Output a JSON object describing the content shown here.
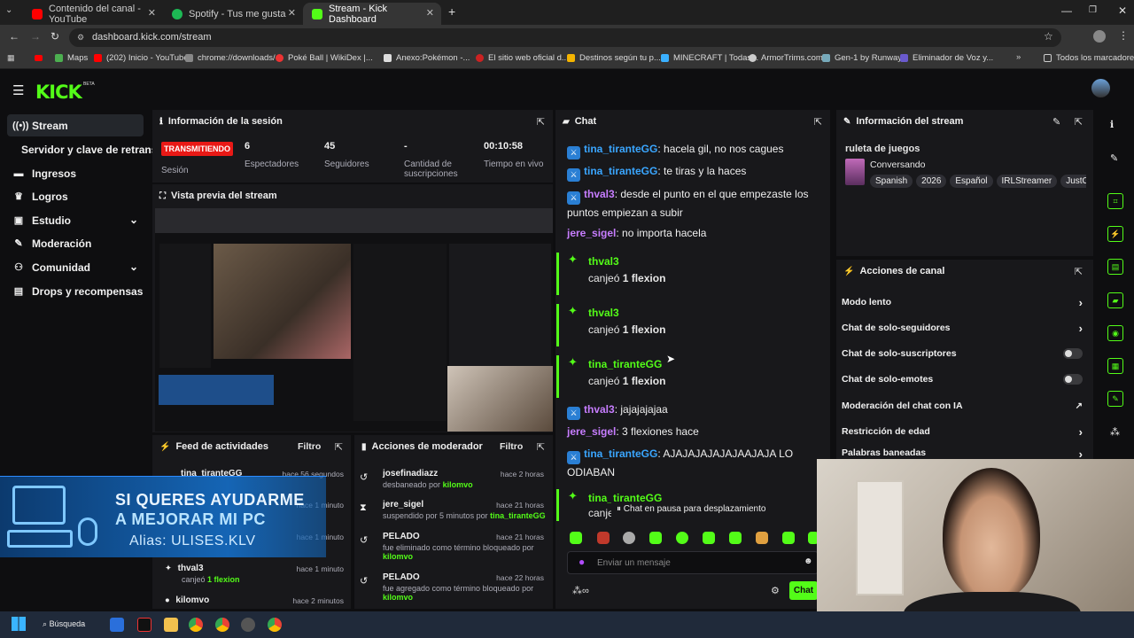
{
  "browser": {
    "tabs": [
      {
        "label": "Contenido del canal - YouTube",
        "color": "#ff0000"
      },
      {
        "label": "Spotify - Tus me gusta",
        "color": "#1db954"
      },
      {
        "label": "Stream - Kick Dashboard",
        "color": "#53fc18"
      }
    ],
    "url": "dashboard.kick.com/stream",
    "bookmarks": [
      "Maps",
      "(202) Inicio - YouTube",
      "chrome://downloads/",
      "Poké Ball | WikiDex |...",
      "Anexo:Pokémon -...",
      "El sitio web oficial d...",
      "Destinos según tu p...",
      "MINECRAFT | Todas...",
      "ArmorTrims.com",
      "Gen-1 by Runway",
      "Eliminador de Voz y...",
      "Todos los marcadores"
    ]
  },
  "kick": {
    "logo": "KICK",
    "logo_badge": "BETA",
    "sidebar": [
      {
        "label": "Stream",
        "icon": "broadcast-icon"
      },
      {
        "label": "Servidor y clave de retransmisión",
        "icon": ""
      },
      {
        "label": "Ingresos",
        "icon": "wallet-icon"
      },
      {
        "label": "Logros",
        "icon": "trophy-icon"
      },
      {
        "label": "Estudio",
        "icon": "studio-icon"
      },
      {
        "label": "Moderación",
        "icon": "wrench-icon"
      },
      {
        "label": "Comunidad",
        "icon": "community-icon"
      },
      {
        "label": "Drops y recompensas",
        "icon": "gift-icon"
      }
    ],
    "session": {
      "title": "Información de la sesión",
      "status": "TRANSMITIENDO",
      "status_label": "Sesión",
      "stats": [
        {
          "value": "6",
          "label": "Espectadores"
        },
        {
          "value": "45",
          "label": "Seguidores"
        },
        {
          "value": "-",
          "label": "Cantidad de suscripciones"
        },
        {
          "value": "00:10:58",
          "label": "Tiempo en vivo"
        }
      ]
    },
    "preview": {
      "title": "Vista previa del stream"
    },
    "overlay": {
      "line1": "SI QUERES AYUDARME",
      "line2": "A MEJORAR MI PC",
      "line3": "Alias: ULISES.KLV"
    },
    "activity": {
      "title": "Feed de actividades",
      "filter": "Filtro",
      "items": [
        {
          "user": "tina_tiranteGG",
          "time": "hace 56 segundos",
          "text": ""
        },
        {
          "user": "",
          "time": "hace 1 minuto",
          "text": ""
        },
        {
          "user": "",
          "time": "hace 1 minuto",
          "text": ""
        },
        {
          "user": "thval3",
          "time": "hace 1 minuto",
          "text": "canjeó",
          "reward": "1 flexion"
        },
        {
          "user": "kilomvo",
          "time": "hace 2 minutos",
          "text": ""
        }
      ]
    },
    "modactions": {
      "title": "Acciones de moderador",
      "filter": "Filtro",
      "items": [
        {
          "user": "josefinadiazz",
          "time": "hace 2 horas",
          "text": "desbaneado por",
          "by": "kilomvo"
        },
        {
          "user": "jere_sigel",
          "time": "hace 21 horas",
          "text": "suspendido por 5 minutos por",
          "by": "tina_tiranteGG"
        },
        {
          "user": "PELADO",
          "time": "hace 21 horas",
          "text": "fue eliminado como término bloqueado por",
          "by": "kilomvo"
        },
        {
          "user": "PELADO",
          "time": "hace 22 horas",
          "text": "fue agregado como término bloqueado por",
          "by": "kilomvo"
        }
      ]
    },
    "chat": {
      "title": "Chat",
      "messages": [
        {
          "user": "tina_tiranteGG",
          "color": "#3aa6ff",
          "badge": true,
          "text": "hacela gil, no nos cagues"
        },
        {
          "user": "tina_tiranteGG",
          "color": "#3aa6ff",
          "badge": true,
          "text": "te tiras y la haces"
        },
        {
          "user": "thval3",
          "color": "#c77dff",
          "badge": true,
          "text": "desde el punto en el que empezaste los puntos empiezan a subir"
        },
        {
          "user": "jere_sigel",
          "color": "#c77dff",
          "badge": false,
          "text": "no importa hacela"
        }
      ],
      "redeems": [
        {
          "user": "thval3",
          "verb": "canjeó",
          "reward": "1 flexion"
        },
        {
          "user": "thval3",
          "verb": "canjeó",
          "reward": "1 flexion"
        },
        {
          "user": "tina_tiranteGG",
          "verb": "canjeó",
          "reward": "1 flexion"
        }
      ],
      "messages2": [
        {
          "user": "thval3",
          "color": "#c77dff",
          "badge": true,
          "text": "jajajajajaa"
        },
        {
          "user": "jere_sigel",
          "color": "#c77dff",
          "badge": false,
          "text": "3 flexiones hace"
        },
        {
          "user": "tina_tiranteGG",
          "color": "#3aa6ff",
          "badge": true,
          "text": "AJAJAJAJAJAJAAJAJA LO ODIABAN"
        }
      ],
      "last_redeem": {
        "user": "tina_tiranteGG",
        "verb": "canjeó"
      },
      "paused": "Chat en pausa para desplazamiento",
      "placeholder": "Enviar un mensaje",
      "send_label": "Chat"
    },
    "stream_info": {
      "title": "Información del stream",
      "stream_title": "ruleta de juegos",
      "category": "Conversando",
      "tags": [
        "Spanish",
        "2026",
        "Español",
        "IRLStreamer",
        "JustC"
      ]
    },
    "channel_actions": {
      "title": "Acciones de canal",
      "items": [
        {
          "label": "Modo lento",
          "kind": "chevron"
        },
        {
          "label": "Chat de solo-seguidores",
          "kind": "chevron"
        },
        {
          "label": "Chat de solo-suscriptores",
          "kind": "toggle"
        },
        {
          "label": "Chat de solo-emotes",
          "kind": "toggle"
        },
        {
          "label": "Moderación del chat con IA",
          "kind": "external"
        },
        {
          "label": "Restricción de edad",
          "kind": "chevron"
        },
        {
          "label": "Palabras baneadas",
          "kind": "chevron"
        }
      ]
    }
  },
  "taskbar": {
    "search": "Búsqueda"
  },
  "colors": {
    "accent": "#53fc18",
    "bg": "#0e0e10",
    "panel": "#18181b",
    "live": "#e91916"
  }
}
